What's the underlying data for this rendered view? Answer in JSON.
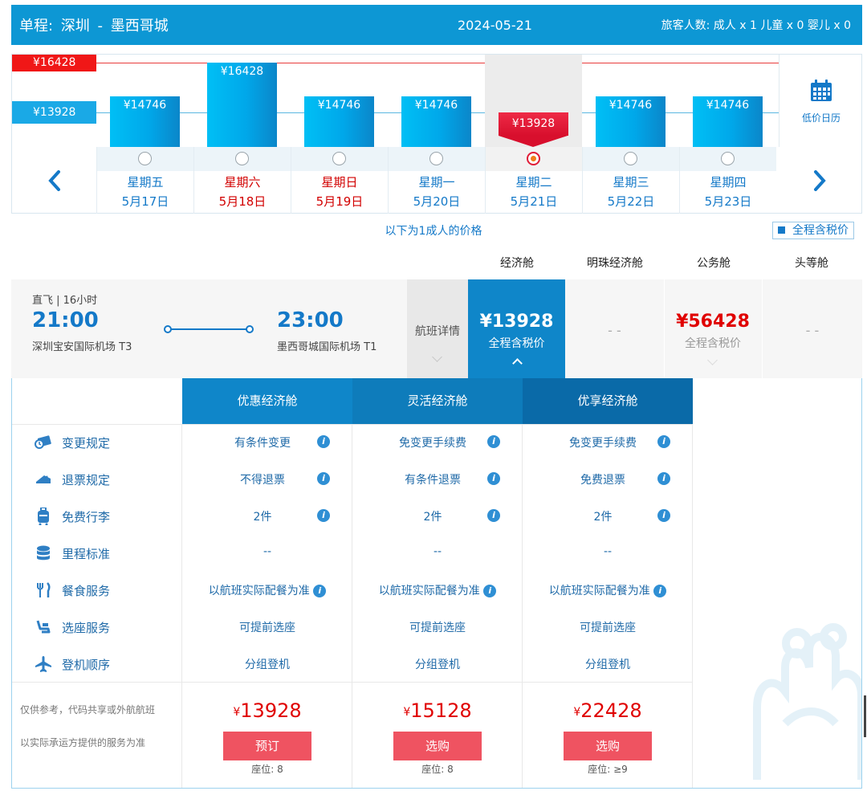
{
  "header": {
    "trip_type": "单程:",
    "origin": "深圳",
    "separator": "-",
    "destination": "墨西哥城",
    "date": "2024-05-21",
    "passengers": "旅客人数: 成人 x 1   儿童 x 0   婴儿 x 0"
  },
  "calendar": {
    "max_price": "¥16428",
    "min_price": "¥13928",
    "low_calendar_label": "低价日历",
    "days": [
      {
        "weekday": "星期五",
        "date": "5月17日",
        "price": "¥14746",
        "value": 14746,
        "weekend": false,
        "selected": false
      },
      {
        "weekday": "星期六",
        "date": "5月18日",
        "price": "¥16428",
        "value": 16428,
        "weekend": true,
        "selected": false
      },
      {
        "weekday": "星期日",
        "date": "5月19日",
        "price": "¥14746",
        "value": 14746,
        "weekend": true,
        "selected": false
      },
      {
        "weekday": "星期一",
        "date": "5月20日",
        "price": "¥14746",
        "value": 14746,
        "weekend": false,
        "selected": false
      },
      {
        "weekday": "星期二",
        "date": "5月21日",
        "price": "¥13928",
        "value": 13928,
        "weekend": false,
        "selected": true
      },
      {
        "weekday": "星期三",
        "date": "5月22日",
        "price": "¥14746",
        "value": 14746,
        "weekend": false,
        "selected": false
      },
      {
        "weekday": "星期四",
        "date": "5月23日",
        "price": "¥14746",
        "value": 14746,
        "weekend": false,
        "selected": false
      }
    ]
  },
  "notice": {
    "adult_price": "以下为1成人的价格",
    "tax_toggle": "全程含税价"
  },
  "cabins": [
    "经济舱",
    "明珠经济舱",
    "公务舱",
    "头等舱"
  ],
  "flight": {
    "type": "直飞 | 16小时",
    "dep_time": "21:00",
    "dep_airport": "深圳宝安国际机场 T3",
    "arr_time": "23:00",
    "arr_airport": "墨西哥城国际机场 T1",
    "detail_label": "航班详情",
    "economy_price": "¥13928",
    "economy_sub": "全程含税价",
    "premium_placeholder": "- -",
    "business_price": "¥56428",
    "business_sub": "全程含税价",
    "first_placeholder": "- -"
  },
  "fares": {
    "columns": [
      "优惠经济舱",
      "灵活经济舱",
      "优享经济舱"
    ],
    "rows": [
      {
        "label": "变更规定",
        "icon": "change-ticket-icon",
        "values": [
          "有条件变更",
          "免变更手续费",
          "免变更手续费"
        ],
        "info": true
      },
      {
        "label": "退票规定",
        "icon": "refund-ticket-icon",
        "values": [
          "不得退票",
          "有条件退票",
          "免费退票"
        ],
        "info": true
      },
      {
        "label": "免费行李",
        "icon": "luggage-icon",
        "values": [
          "2件",
          "2件",
          "2件"
        ],
        "info": true
      },
      {
        "label": "里程标准",
        "icon": "mileage-icon",
        "values": [
          "--",
          "--",
          "--"
        ],
        "info": false
      },
      {
        "label": "餐食服务",
        "icon": "meal-icon",
        "values": [
          "以航班实际配餐为准",
          "以航班实际配餐为准",
          "以航班实际配餐为准"
        ],
        "info": true
      },
      {
        "label": "选座服务",
        "icon": "seat-icon",
        "values": [
          "可提前选座",
          "可提前选座",
          "可提前选座"
        ],
        "info": false
      },
      {
        "label": "登机顺序",
        "icon": "plane-icon",
        "values": [
          "分组登机",
          "分组登机",
          "分组登机"
        ],
        "info": false
      }
    ],
    "footnote_1": "仅供参考，代码共享或外航航班",
    "footnote_2": "以实际承运方提供的服务为准",
    "currency": "¥",
    "prices": [
      "13928",
      "15128",
      "22428"
    ],
    "buttons": [
      "预订",
      "选购",
      "选购"
    ],
    "seats": [
      "座位: 8",
      "座位: 8",
      "座位: ≥9"
    ]
  },
  "colors": {
    "brand_blue": "#0d97d4",
    "accent_red": "#f01717",
    "button_red": "#ef5361"
  }
}
